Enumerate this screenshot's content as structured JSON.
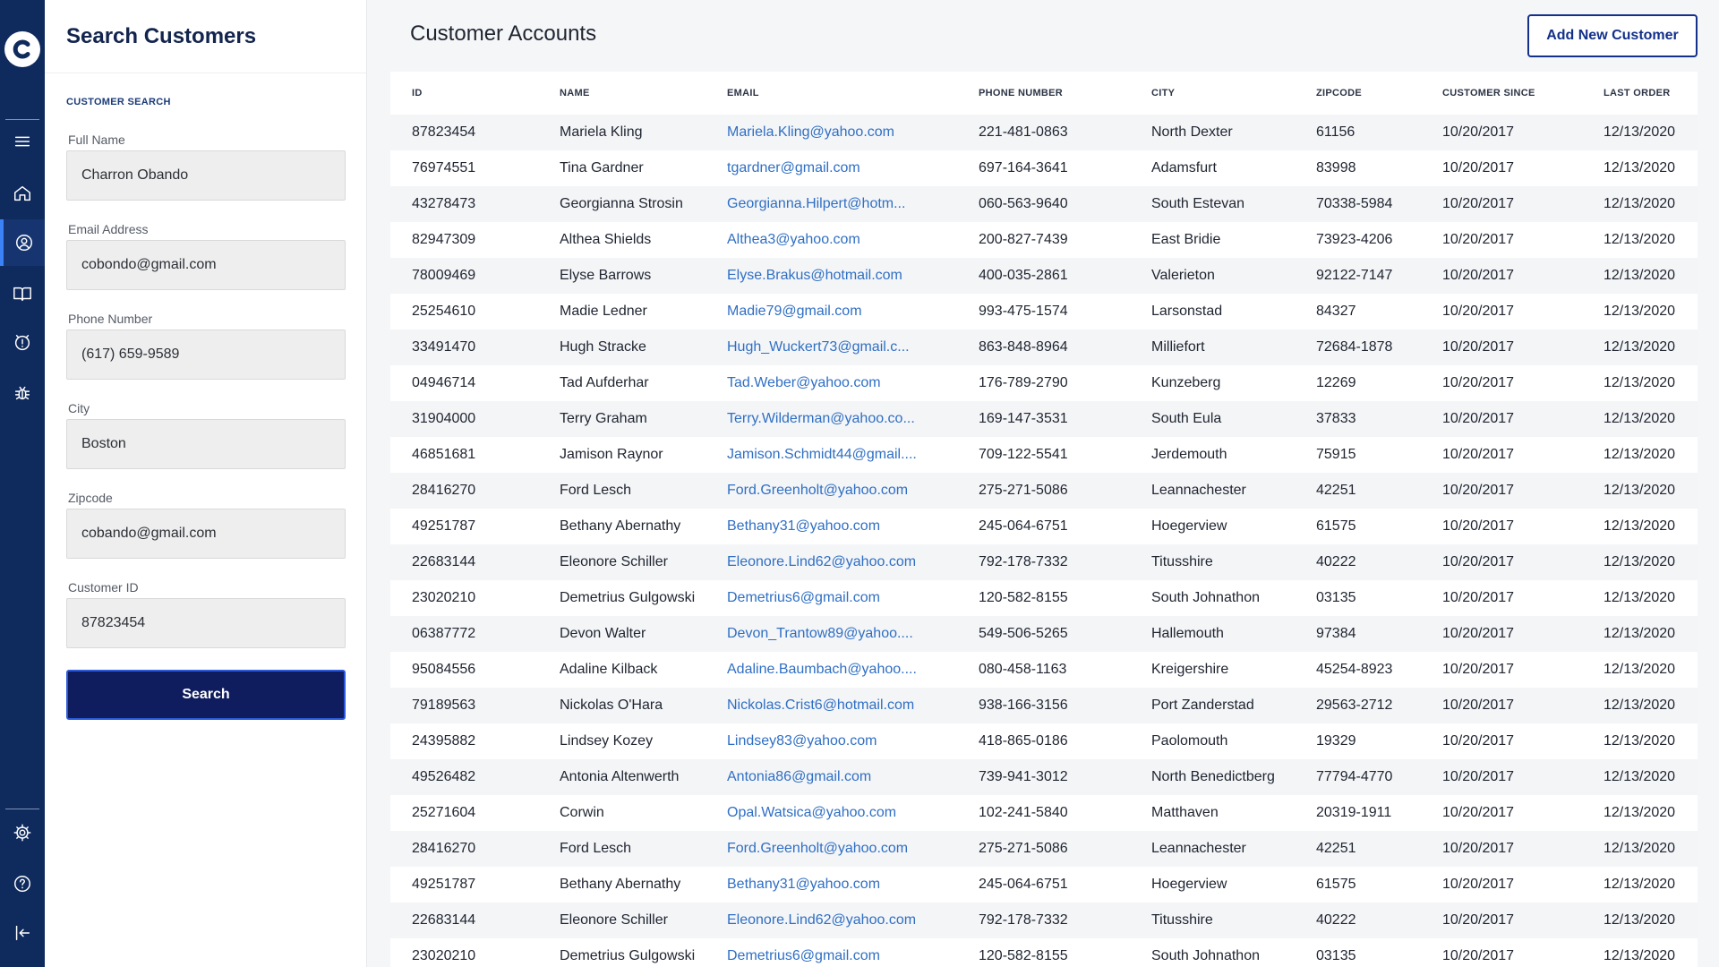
{
  "rail": {
    "logo_letter": "C",
    "items": [
      {
        "name": "menu-icon"
      },
      {
        "name": "home-icon"
      },
      {
        "name": "user-icon",
        "active": true
      },
      {
        "name": "book-icon"
      },
      {
        "name": "badge-alert-icon"
      },
      {
        "name": "bug-icon"
      },
      {
        "name": "gear-icon"
      },
      {
        "name": "help-icon"
      },
      {
        "name": "logout-icon"
      }
    ]
  },
  "search_panel": {
    "title": "Search Customers",
    "section_label": "CUSTOMER SEARCH",
    "fields": [
      {
        "label": "Full Name",
        "value": "Charron Obando"
      },
      {
        "label": "Email Address",
        "value": "cobondo@gmail.com"
      },
      {
        "label": "Phone Number",
        "value": "(617) 659-9589"
      },
      {
        "label": "City",
        "value": "Boston"
      },
      {
        "label": "Zipcode",
        "value": "cobando@gmail.com"
      },
      {
        "label": "Customer ID",
        "value": "87823454"
      }
    ],
    "search_label": "Search"
  },
  "main": {
    "title": "Customer Accounts",
    "add_label": "Add New Customer"
  },
  "table": {
    "columns": [
      "ID",
      "NAME",
      "EMAIL",
      "PHONE NUMBER",
      "CITY",
      "ZIPCODE",
      "CUSTOMER SINCE",
      "LAST ORDER"
    ],
    "rows": [
      [
        "87823454",
        "Mariela Kling",
        "Mariela.Kling@yahoo.com",
        "221-481-0863",
        "North Dexter",
        "61156",
        "10/20/2017",
        "12/13/2020"
      ],
      [
        "76974551",
        "Tina Gardner",
        "tgardner@gmail.com",
        "697-164-3641",
        "Adamsfurt",
        "83998",
        "10/20/2017",
        "12/13/2020"
      ],
      [
        "43278473",
        "Georgianna Strosin",
        "Georgianna.Hilpert@hotm...",
        "060-563-9640",
        "South Estevan",
        "70338-5984",
        "10/20/2017",
        "12/13/2020"
      ],
      [
        "82947309",
        "Althea Shields",
        "Althea3@yahoo.com",
        "200-827-7439",
        "East Bridie",
        "73923-4206",
        "10/20/2017",
        "12/13/2020"
      ],
      [
        "78009469",
        "Elyse Barrows",
        "Elyse.Brakus@hotmail.com",
        "400-035-2861",
        "Valerieton",
        "92122-7147",
        "10/20/2017",
        "12/13/2020"
      ],
      [
        "25254610",
        "Madie Ledner",
        "Madie79@gmail.com",
        "993-475-1574",
        "Larsonstad",
        "84327",
        "10/20/2017",
        "12/13/2020"
      ],
      [
        "33491470",
        "Hugh Stracke",
        "Hugh_Wuckert73@gmail.c...",
        "863-848-8964",
        "Milliefort",
        "72684-1878",
        "10/20/2017",
        "12/13/2020"
      ],
      [
        "04946714",
        "Tad Aufderhar",
        "Tad.Weber@yahoo.com",
        "176-789-2790",
        "Kunzeberg",
        "12269",
        "10/20/2017",
        "12/13/2020"
      ],
      [
        "31904000",
        "Terry Graham",
        "Terry.Wilderman@yahoo.co...",
        "169-147-3531",
        "South Eula",
        "37833",
        "10/20/2017",
        "12/13/2020"
      ],
      [
        "46851681",
        "Jamison Raynor",
        "Jamison.Schmidt44@gmail....",
        "709-122-5541",
        "Jerdemouth",
        "75915",
        "10/20/2017",
        "12/13/2020"
      ],
      [
        "28416270",
        "Ford Lesch",
        "Ford.Greenholt@yahoo.com",
        "275-271-5086",
        "Leannachester",
        "42251",
        "10/20/2017",
        "12/13/2020"
      ],
      [
        "49251787",
        "Bethany Abernathy",
        "Bethany31@yahoo.com",
        "245-064-6751",
        "Hoegerview",
        "61575",
        "10/20/2017",
        "12/13/2020"
      ],
      [
        "22683144",
        "Eleonore Schiller",
        "Eleonore.Lind62@yahoo.com",
        "792-178-7332",
        "Titusshire",
        "40222",
        "10/20/2017",
        "12/13/2020"
      ],
      [
        "23020210",
        "Demetrius Gulgowski",
        "Demetrius6@gmail.com",
        "120-582-8155",
        "South Johnathon",
        "03135",
        "10/20/2017",
        "12/13/2020"
      ],
      [
        "06387772",
        "Devon Walter",
        "Devon_Trantow89@yahoo....",
        "549-506-5265",
        "Hallemouth",
        "97384",
        "10/20/2017",
        "12/13/2020"
      ],
      [
        "95084556",
        "Adaline Kilback",
        "Adaline.Baumbach@yahoo....",
        "080-458-1163",
        "Kreigershire",
        "45254-8923",
        "10/20/2017",
        "12/13/2020"
      ],
      [
        "79189563",
        "Nickolas O'Hara",
        "Nickolas.Crist6@hotmail.com",
        "938-166-3156",
        "Port Zanderstad",
        "29563-2712",
        "10/20/2017",
        "12/13/2020"
      ],
      [
        "24395882",
        "Lindsey Kozey",
        "Lindsey83@yahoo.com",
        "418-865-0186",
        "Paolomouth",
        "19329",
        "10/20/2017",
        "12/13/2020"
      ],
      [
        "49526482",
        "Antonia Altenwerth",
        "Antonia86@gmail.com",
        "739-941-3012",
        "North Benedictberg",
        "77794-4770",
        "10/20/2017",
        "12/13/2020"
      ],
      [
        "25271604",
        "Corwin",
        "Opal.Watsica@yahoo.com",
        "102-241-5840",
        "Matthaven",
        "20319-1911",
        "10/20/2017",
        "12/13/2020"
      ],
      [
        "28416270",
        "Ford Lesch",
        "Ford.Greenholt@yahoo.com",
        "275-271-5086",
        "Leannachester",
        "42251",
        "10/20/2017",
        "12/13/2020"
      ],
      [
        "49251787",
        "Bethany Abernathy",
        "Bethany31@yahoo.com",
        "245-064-6751",
        "Hoegerview",
        "61575",
        "10/20/2017",
        "12/13/2020"
      ],
      [
        "22683144",
        "Eleonore Schiller",
        "Eleonore.Lind62@yahoo.com",
        "792-178-7332",
        "Titusshire",
        "40222",
        "10/20/2017",
        "12/13/2020"
      ],
      [
        "23020210",
        "Demetrius Gulgowski",
        "Demetrius6@gmail.com",
        "120-582-8155",
        "South Johnathon",
        "03135",
        "10/20/2017",
        "12/13/2020"
      ]
    ]
  },
  "colors": {
    "rail": "#0f2a5c",
    "primary_button": "#0f1d5e",
    "link": "#2f6fc4",
    "accent": "#13308a"
  }
}
